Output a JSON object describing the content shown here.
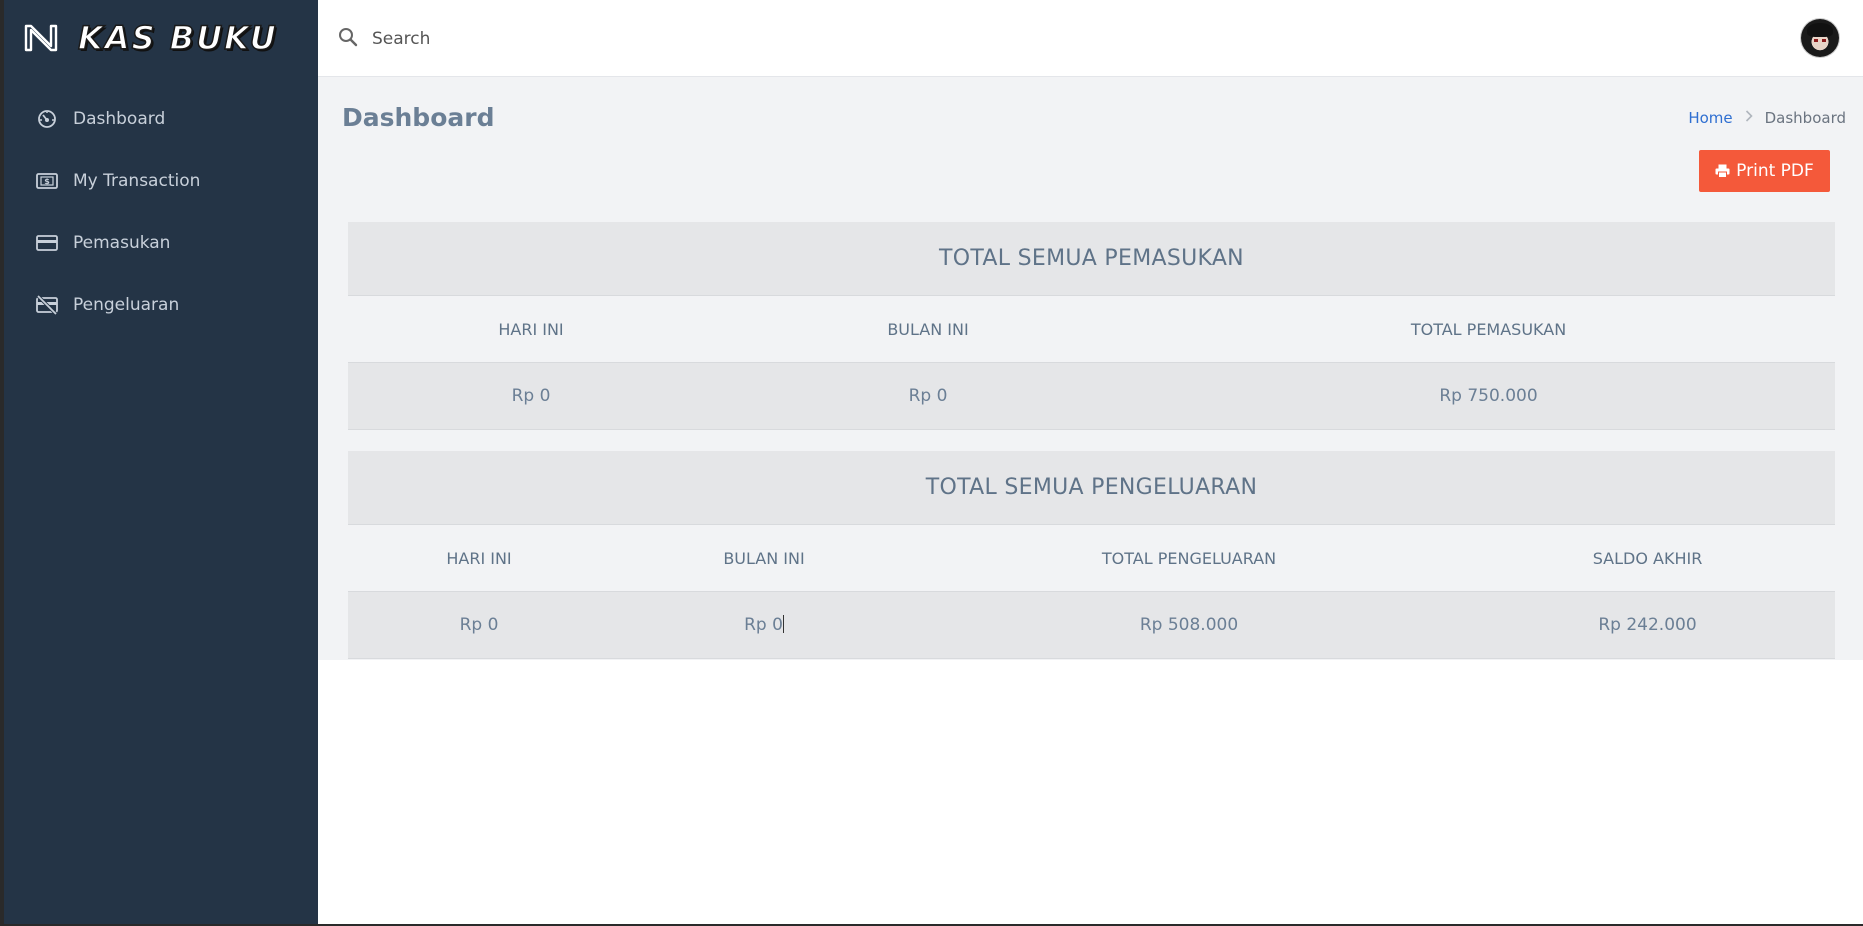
{
  "brand": {
    "title": "KAS BUKU",
    "logo_icon": "n-logo-icon"
  },
  "sidebar": {
    "items": [
      {
        "label": "Dashboard",
        "icon": "dashboard-gauge-icon"
      },
      {
        "label": "My Transaction",
        "icon": "money-bill-icon"
      },
      {
        "label": "Pemasukan",
        "icon": "credit-card-icon"
      },
      {
        "label": "Pengeluaran",
        "icon": "card-off-icon"
      }
    ]
  },
  "topbar": {
    "search_placeholder": "Search",
    "search_icon": "search-icon",
    "avatar_icon": "user-avatar"
  },
  "page": {
    "title": "Dashboard",
    "breadcrumb": {
      "home": "Home",
      "separator": ">",
      "current": "Dashboard"
    },
    "print_button": "Print PDF"
  },
  "pemasukan": {
    "heading": "TOTAL SEMUA PEMASUKAN",
    "columns": [
      "HARI INI",
      "BULAN INI",
      "TOTAL PEMASUKAN"
    ],
    "values": [
      "Rp 0",
      "Rp 0",
      "Rp 750.000"
    ]
  },
  "pengeluaran": {
    "heading": "TOTAL SEMUA PENGELUARAN",
    "columns": [
      "HARI INI",
      "BULAN INI",
      "TOTAL PENGELUARAN",
      "SALDO AKHIR"
    ],
    "values": [
      "Rp 0",
      "Rp 0",
      "Rp 508.000",
      "Rp 242.000"
    ]
  },
  "colors": {
    "sidebar_bg": "#243446",
    "accent_button": "#f4593a",
    "link": "#2f6fd1"
  }
}
